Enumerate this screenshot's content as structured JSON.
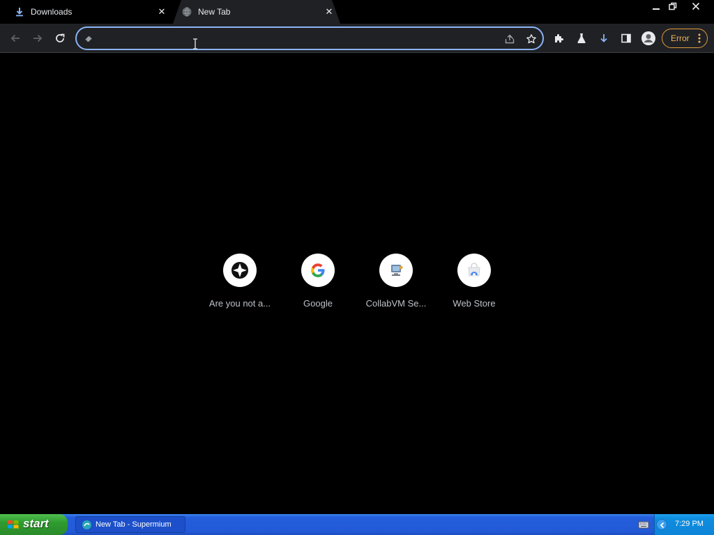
{
  "tabs": [
    {
      "title": "Downloads",
      "icon": "download-icon",
      "active": false
    },
    {
      "title": "New Tab",
      "icon": "globe-icon",
      "active": true
    }
  ],
  "window_controls": [
    "minimize-icon",
    "restore-icon",
    "close-icon"
  ],
  "omnibox": {
    "value": "",
    "placeholder": ""
  },
  "profile": {
    "error_label": "Error"
  },
  "shortcuts": [
    {
      "label": "Are you not a...",
      "icon": "compass-icon"
    },
    {
      "label": "Google",
      "icon": "google-g-icon"
    },
    {
      "label": "CollabVM Se...",
      "icon": "collabvm-icon"
    },
    {
      "label": "Web Store",
      "icon": "webstore-icon"
    }
  ],
  "taskbar": {
    "start_label": "start",
    "task_label": "New Tab - Supermium",
    "clock": "7:29 PM"
  },
  "colors": {
    "accent": "#8ab4f8",
    "error": "#f5b55b",
    "toolbar": "#202124",
    "taskbar": "#245edb",
    "start": "#2f9b2f"
  }
}
